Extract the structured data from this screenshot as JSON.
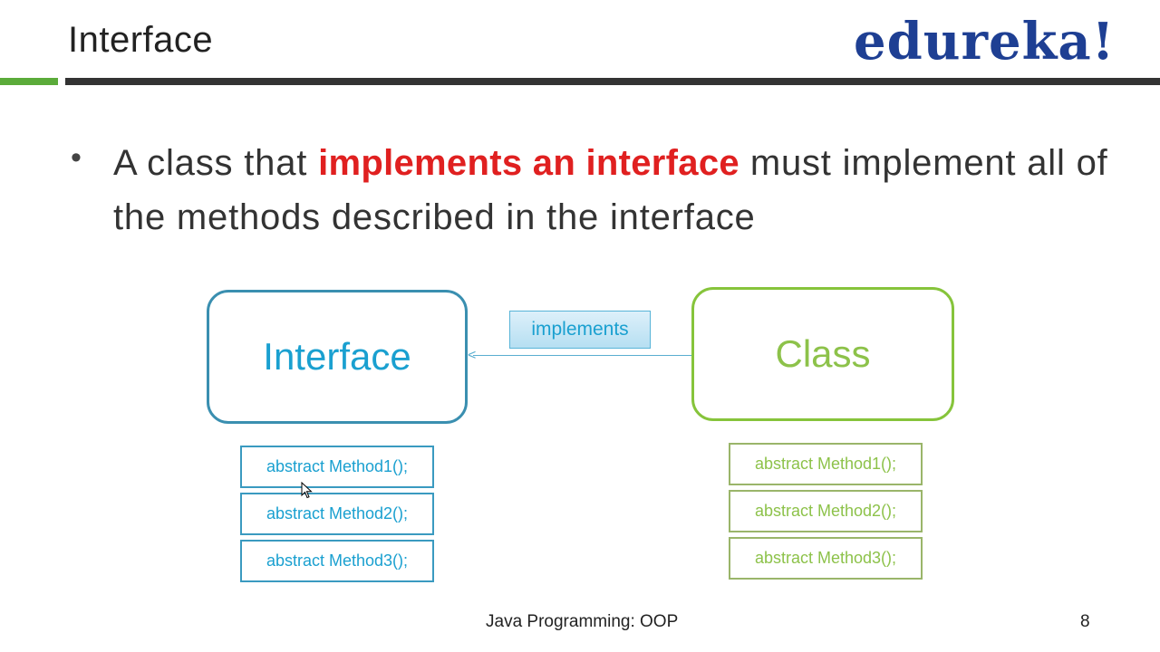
{
  "header": {
    "title": "Interface",
    "logo_text": "edureka!"
  },
  "bullet": {
    "text_before": "A class that ",
    "highlight": "implements an interface",
    "text_after": " must implement all of the methods described in the interface"
  },
  "diagram": {
    "interface_label": "Interface",
    "class_label": "Class",
    "relation_label": "implements",
    "interface_methods": [
      "abstract Method1();",
      "abstract Method2();",
      "abstract Method3();"
    ],
    "class_methods": [
      "abstract Method1();",
      "abstract Method2();",
      "abstract Method3();"
    ]
  },
  "footer": {
    "caption": "Java Programming: OOP",
    "page_number": "8"
  },
  "colors": {
    "interface_blue": "#1aa0d0",
    "class_green": "#8dc24a",
    "highlight_red": "#e02020",
    "logo_blue": "#1e3f93",
    "accent_green": "#5bab3a"
  }
}
